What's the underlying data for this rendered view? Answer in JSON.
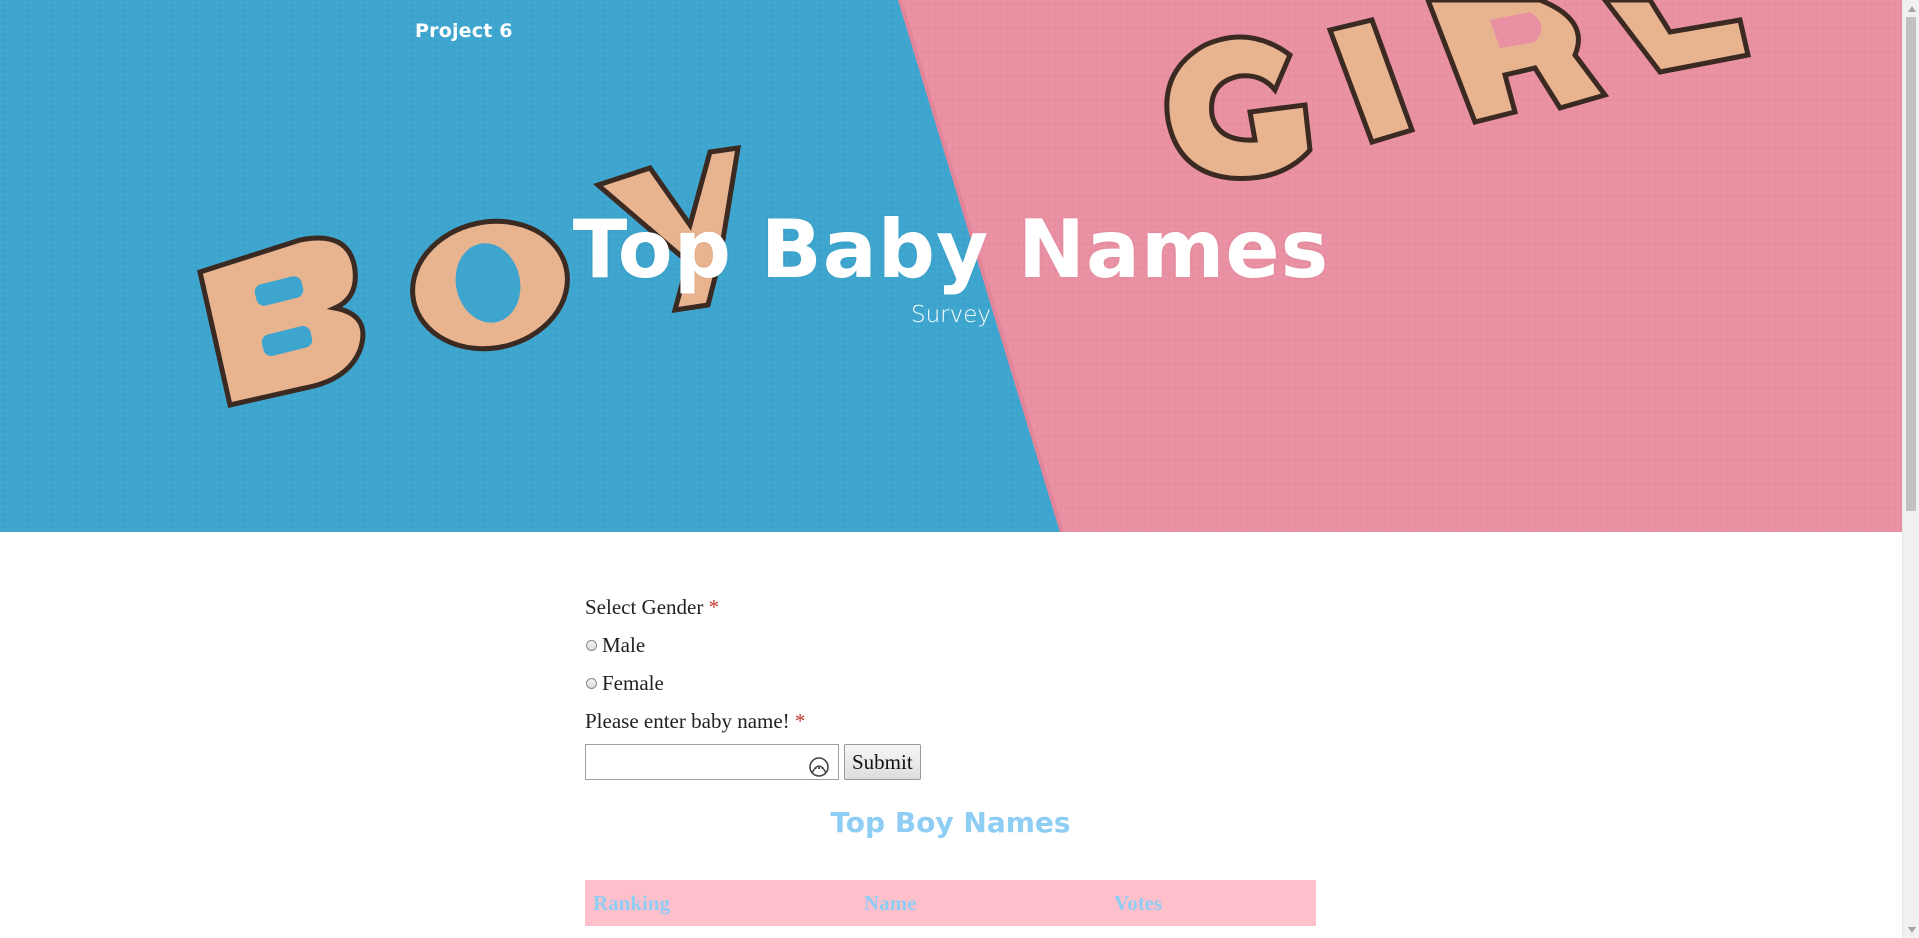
{
  "nav": {
    "brand": "Project 6"
  },
  "hero": {
    "title": "Top Baby Names",
    "subtitle": "Survey"
  },
  "form": {
    "gender_label": "Select Gender",
    "required_mark": "*",
    "options": [
      {
        "label": "Male",
        "selected": false
      },
      {
        "label": "Female",
        "selected": false
      }
    ],
    "name_label": "Please enter baby name!",
    "name_input_value": "",
    "submit_label": "Submit"
  },
  "boys": {
    "title": "Top Boy Names",
    "columns": [
      "Ranking",
      "Name",
      "Votes"
    ]
  },
  "colors": {
    "boy_blue": "#3fa6cf",
    "girl_pink": "#e88fa1",
    "accent_blue": "#8ecdf4",
    "table_header_bg": "#ffc0cb",
    "required_red": "#c0392b"
  },
  "icons": {
    "input_icon": "password-manager-icon"
  }
}
